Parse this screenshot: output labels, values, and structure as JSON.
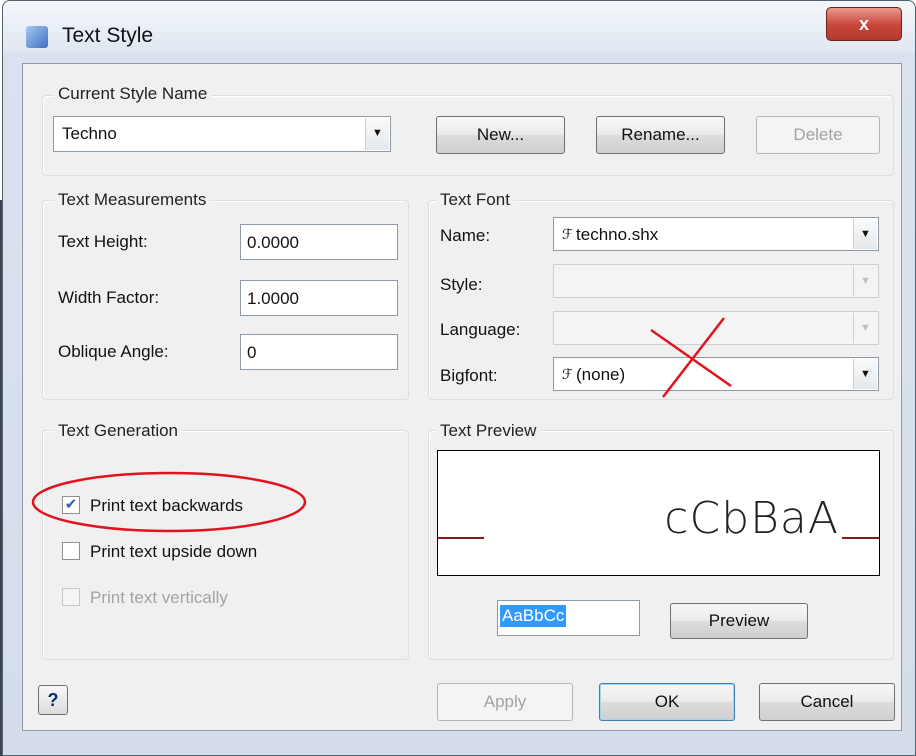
{
  "window": {
    "title": "Text Style",
    "close_glyph": "x"
  },
  "current_style": {
    "group_title": "Current Style Name",
    "value": "Techno",
    "new_label": "New...",
    "rename_label": "Rename...",
    "delete_label": "Delete"
  },
  "measurements": {
    "group_title": "Text Measurements",
    "height_label": "Text Height:",
    "height_value": "0.0000",
    "width_label": "Width Factor:",
    "width_value": "1.0000",
    "oblique_label": "Oblique Angle:",
    "oblique_value": "0"
  },
  "font": {
    "group_title": "Text Font",
    "name_label": "Name:",
    "name_value": "techno.shx",
    "style_label": "Style:",
    "language_label": "Language:",
    "bigfont_label": "Bigfont:",
    "bigfont_value": "(none)",
    "font_icon": "shx-font-icon"
  },
  "generation": {
    "group_title": "Text Generation",
    "backwards_label": "Print text backwards",
    "backwards_checked": true,
    "upside_label": "Print text upside down",
    "upside_checked": false,
    "vertical_label": "Print text vertically",
    "vertical_checked": false
  },
  "preview": {
    "group_title": "Text Preview",
    "rendered_text": "cCbBaA",
    "sample_text": "AaBbCc",
    "preview_label": "Preview"
  },
  "footer": {
    "help_label": "?",
    "apply_label": "Apply",
    "ok_label": "OK",
    "cancel_label": "Cancel"
  },
  "annotation_color": "#e0141e",
  "baseline_color": "#8b1a1a"
}
